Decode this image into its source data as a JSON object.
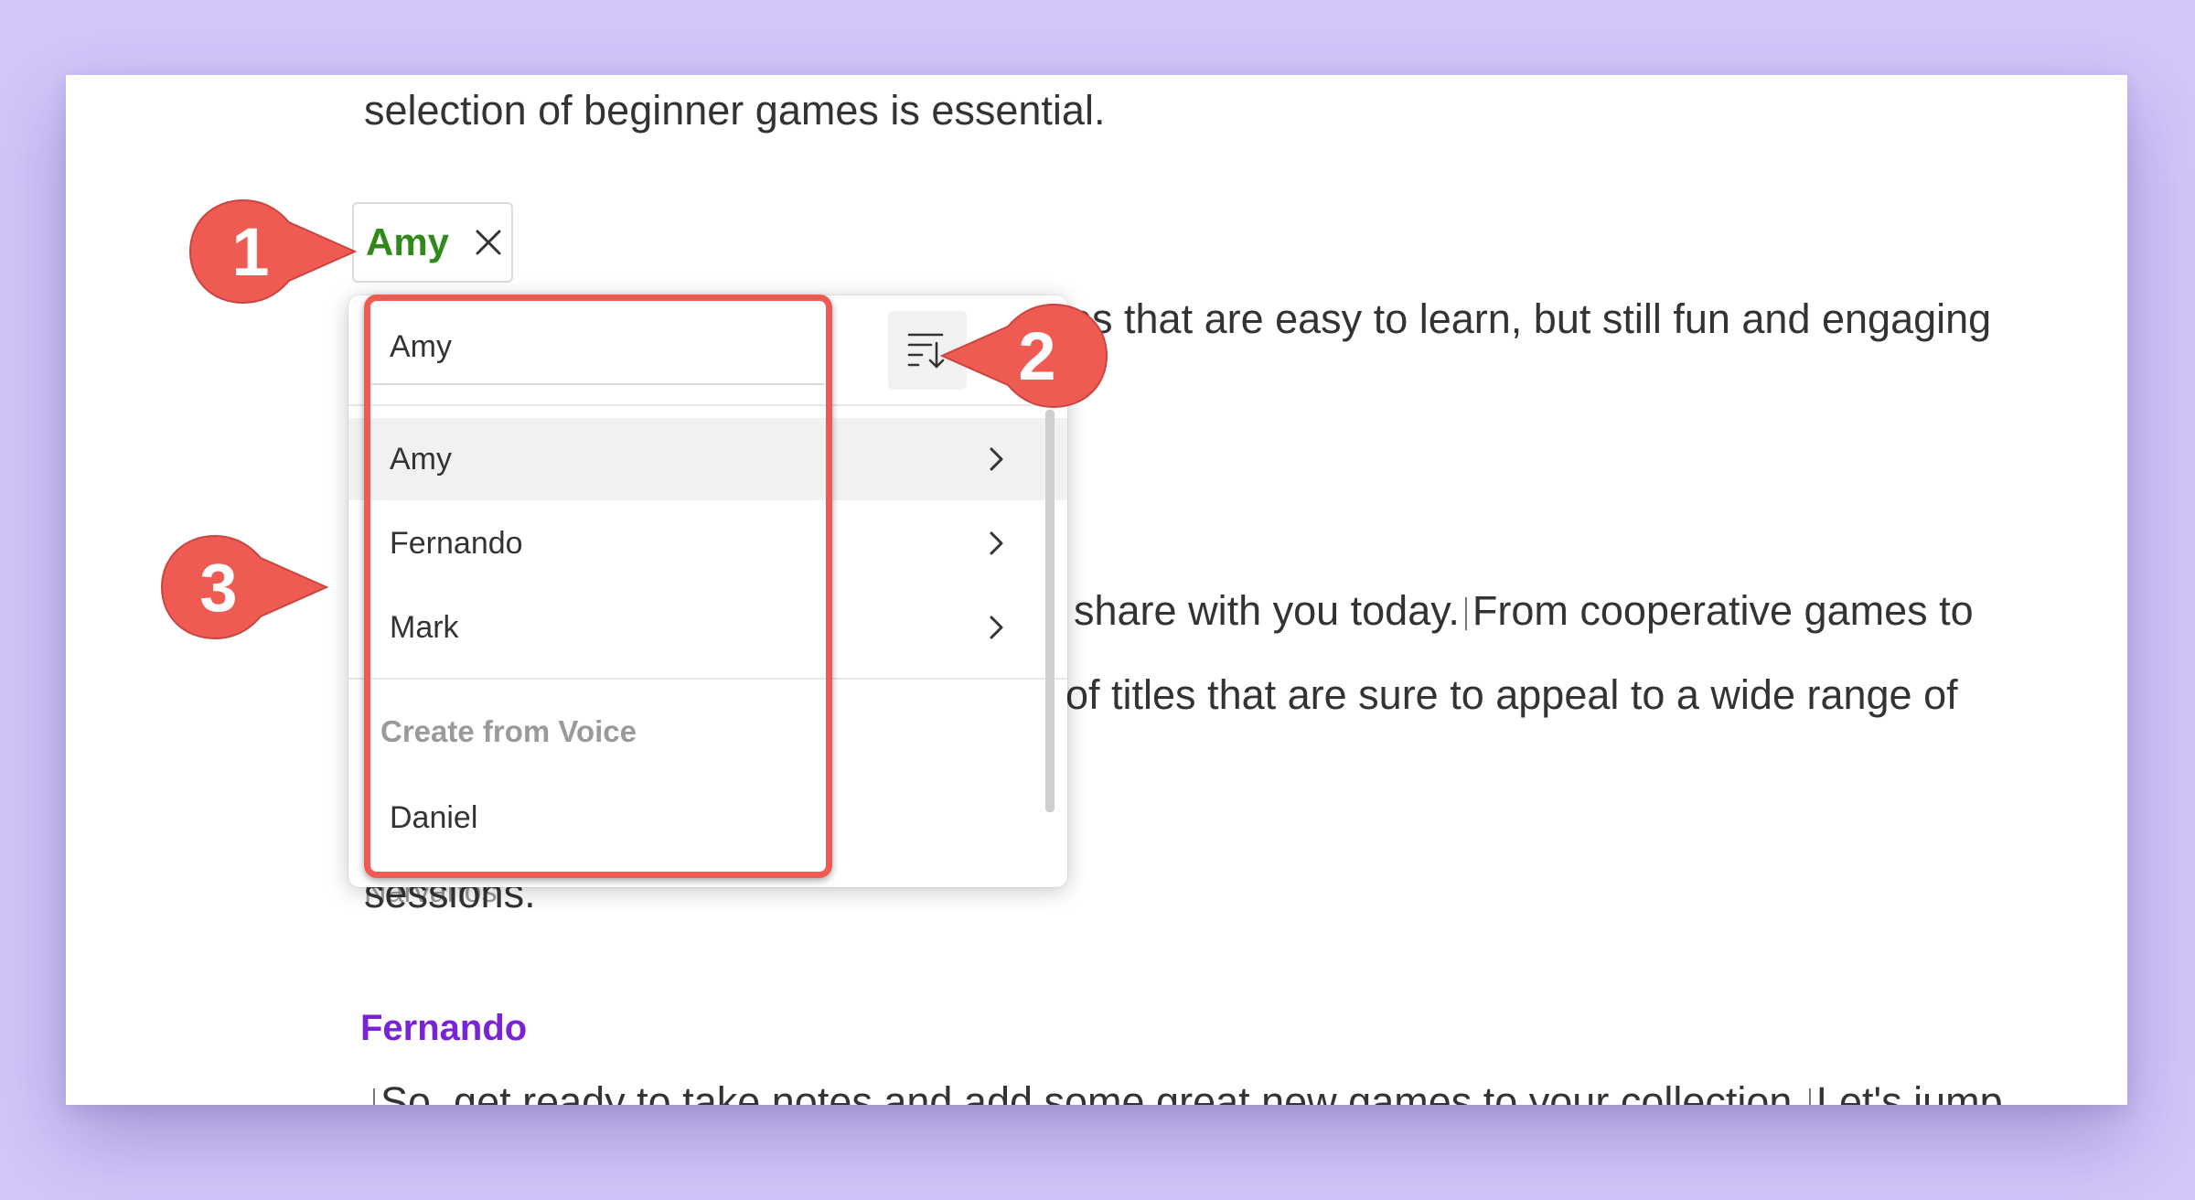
{
  "document": {
    "lines": [
      "selection of beginner games is essential.",
      "es that are easy to learn, but still fun and engaging",
      "share with you today.",
      "From cooperative games to",
      "of titles that are sure to appeal to a wide range of",
      "sessions.",
      "So, get ready to take notes and add some great new games to your collection.",
      "Let's jump"
    ],
    "speaker_chip": {
      "name": "Amy"
    },
    "speaker_second": "Fernando",
    "overlap_text": "Narvanos"
  },
  "dropdown": {
    "search_value": "Amy",
    "search_placeholder": "",
    "sort_icon": "sort-descending-icon",
    "speakers": [
      {
        "label": "Amy",
        "active": true
      },
      {
        "label": "Fernando",
        "active": false
      },
      {
        "label": "Mark",
        "active": false
      }
    ],
    "section_header": "Create from Voice",
    "voices": [
      {
        "label": "Daniel"
      }
    ]
  },
  "callouts": [
    {
      "number": "1"
    },
    {
      "number": "2"
    },
    {
      "number": "3"
    }
  ],
  "colors": {
    "accent_green": "#2f8a1a",
    "accent_purple": "#7a22d6",
    "callout_red": "#ef5a52",
    "background": "#d2c6fa"
  }
}
